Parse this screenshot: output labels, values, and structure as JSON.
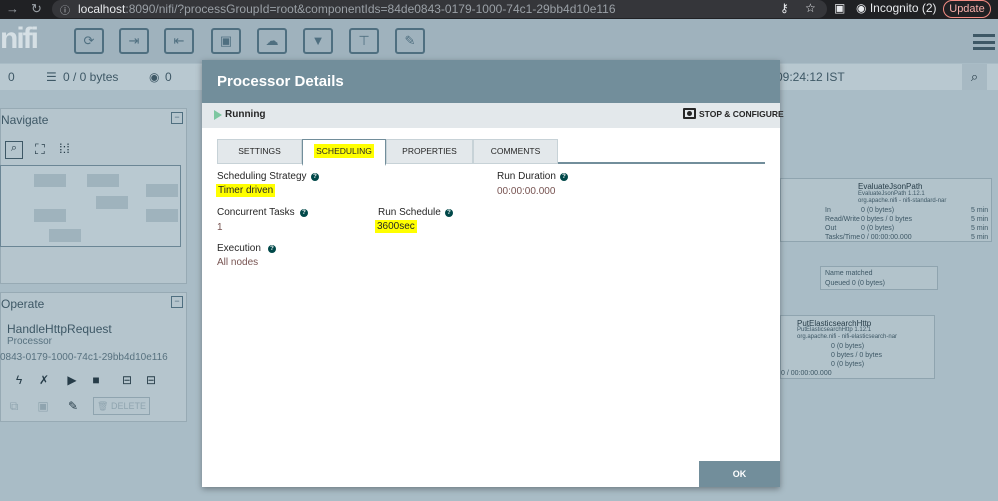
{
  "browser": {
    "url_host": "localhost",
    "url_rest": ":8090/nifi/?processGroupId=root&componentIds=84de0843-0179-1000-74c1-29bb4d10e116",
    "incognito_label": "Incognito (2)",
    "update_label": "Update"
  },
  "nifi": {
    "logo": "nifi",
    "status": {
      "count_left": "0",
      "bytes": "0 / 0 bytes",
      "count_right": "0",
      "time": "09:24:12 IST"
    },
    "navigate_title": "Navigate",
    "operate_title": "Operate",
    "operate_component_name": "HandleHttpRequest",
    "operate_component_type": "Processor",
    "operate_component_id": "0843-0179-1000-74c1-29bb4d10e116",
    "delete_label": "DELETE",
    "cards": {
      "evaluate_name": "EvaluateJsonPath",
      "evaluate_version": "EvaluateJsonPath 1.12.1",
      "evaluate_bundle": "org.apache.nifi - nifi-standard-nar",
      "put_name": "PutElasticsearchHttp",
      "put_version": "PutElasticsearchHttp 1.12.1",
      "put_bundle": "org.apache.nifi - nifi-elasticsearch-nar",
      "conn_name_label": "Name",
      "conn_name_value": "matched",
      "conn_queued_label": "Queued",
      "conn_queued_value": "0 (0 bytes)",
      "row_in": "In",
      "row_in_val": "0 (0 bytes)",
      "row_rw": "Read/Write",
      "row_rw_val": "0 bytes / 0 bytes",
      "row_out": "Out",
      "row_out_val": "0 (0 bytes)",
      "row_tasks": "Tasks/Time",
      "row_tasks_val": "0 / 00:00:00.000",
      "five_min": "5 min"
    }
  },
  "dialog": {
    "title": "Processor Details",
    "state": "Running",
    "stop_configure": "STOP & CONFIGURE",
    "tabs": [
      "SETTINGS",
      "SCHEDULING",
      "PROPERTIES",
      "COMMENTS"
    ],
    "active_tab": "SCHEDULING",
    "fields": {
      "scheduling_strategy_label": "Scheduling Strategy",
      "scheduling_strategy_value": "Timer driven",
      "run_duration_label": "Run Duration",
      "run_duration_value": "00:00:00.000",
      "concurrent_tasks_label": "Concurrent Tasks",
      "concurrent_tasks_value": "1",
      "run_schedule_label": "Run Schedule",
      "run_schedule_value": "3600sec",
      "execution_label": "Execution",
      "execution_value": "All nodes"
    },
    "ok_label": "OK",
    "highlight_color": "#ffff00",
    "header_color": "#728e9b"
  }
}
